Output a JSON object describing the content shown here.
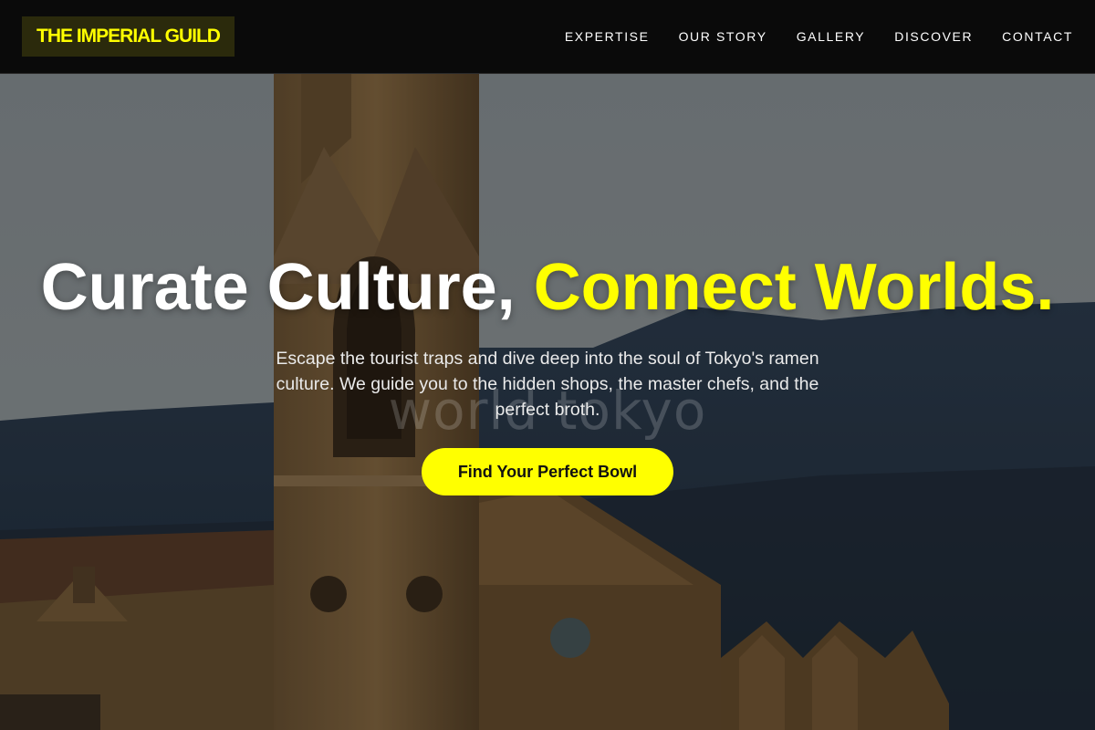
{
  "brand": {
    "name": "THE IMPERIAL GUILD"
  },
  "nav": {
    "items": [
      {
        "label": "EXPERTISE"
      },
      {
        "label": "OUR STORY"
      },
      {
        "label": "GALLERY"
      },
      {
        "label": "DISCOVER"
      },
      {
        "label": "CONTACT"
      }
    ]
  },
  "hero": {
    "headline_part1": "Curate Culture, ",
    "headline_part2": "Connect Worlds.",
    "watermark": "world tokyo",
    "subtitle": "Escape the tourist traps and dive deep into the soul of Tokyo's ramen culture. We guide you to the hidden shops, the master chefs, and the perfect broth.",
    "cta_label": "Find Your Perfect Bowl"
  },
  "colors": {
    "accent": "#ffff00",
    "navbar_bg": "#0a0a0a",
    "logo_bg": "#2b2a0c",
    "text": "#ffffff"
  }
}
